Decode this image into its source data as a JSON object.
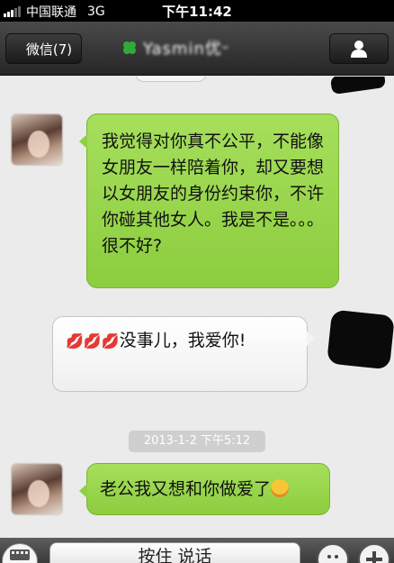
{
  "status_bar": {
    "carrier": "中国联通",
    "network": "3G",
    "time": "下午11:42"
  },
  "nav": {
    "back_label": "微信(7)",
    "contact_name": "Yasmin优ᵕ",
    "profile_icon": "person-icon"
  },
  "messages": [
    {
      "side": "left",
      "type": "green",
      "text": "我觉得对你真不公平，不能像女朋友一样陪着你，却又要想以女朋友的身份约束你，不许你碰其他女人。我是不是。。。很不好?"
    },
    {
      "side": "right",
      "type": "white",
      "lips": "💋💋💋",
      "text": "没事儿，我爱你!"
    },
    {
      "side": "left",
      "type": "green",
      "text": "老公我又想和你做爱了"
    }
  ],
  "timestamp": "2013-1-2 下午5:12",
  "input_bar": {
    "talk_label": "按住 说话",
    "keyboard_icon": "keyboard-icon",
    "emoji_icon": "smiley-icon",
    "plus_icon": "plus-icon"
  }
}
